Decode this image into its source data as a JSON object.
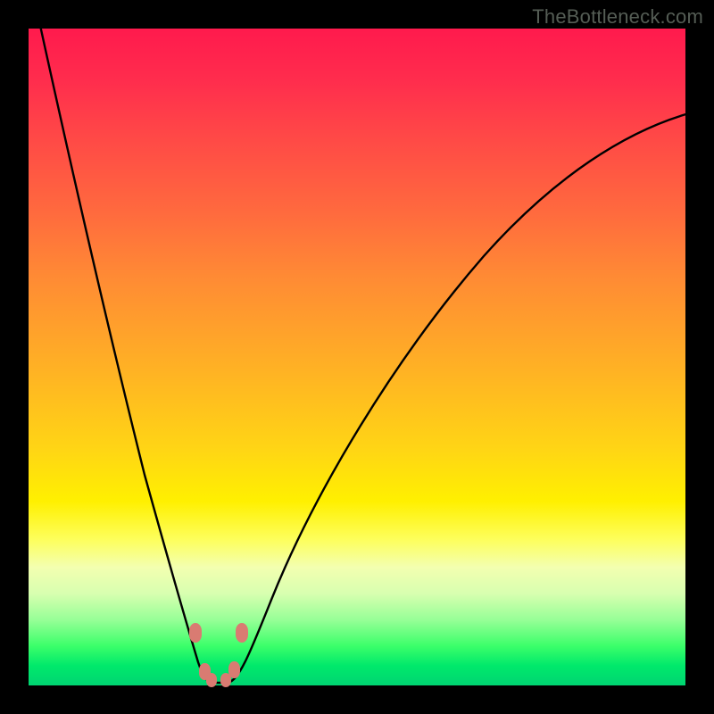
{
  "attribution": "TheBottleneck.com",
  "colors": {
    "gradient_top": "#ff1a4d",
    "gradient_bottom": "#00d472",
    "curve": "#000000",
    "marker": "#d97b72"
  },
  "chart_data": {
    "type": "line",
    "title": "",
    "xlabel": "",
    "ylabel": "",
    "xlim": [
      0,
      100
    ],
    "ylim": [
      0,
      100
    ],
    "x": [
      0,
      2,
      4,
      6,
      8,
      10,
      12,
      14,
      16,
      18,
      20,
      22,
      24,
      26,
      27,
      28,
      30,
      33,
      36,
      40,
      45,
      50,
      55,
      60,
      65,
      70,
      75,
      80,
      85,
      90,
      95,
      100
    ],
    "values": [
      100,
      90,
      80,
      72,
      64,
      56,
      49,
      42,
      35,
      28,
      21,
      15,
      10,
      5,
      2,
      0,
      0,
      2,
      7,
      14,
      22,
      30,
      38,
      45,
      52,
      58,
      64,
      69,
      74,
      78,
      82,
      85
    ],
    "series_name": "bottleneck_pct",
    "minimum_x_range": [
      27,
      30
    ],
    "markers": [
      {
        "x": 25.2,
        "y": 7.5
      },
      {
        "x": 26.5,
        "y": 2.0
      },
      {
        "x": 27.3,
        "y": 0.5
      },
      {
        "x": 29.5,
        "y": 0.6
      },
      {
        "x": 30.3,
        "y": 2.2
      },
      {
        "x": 31.8,
        "y": 7.2
      }
    ]
  }
}
